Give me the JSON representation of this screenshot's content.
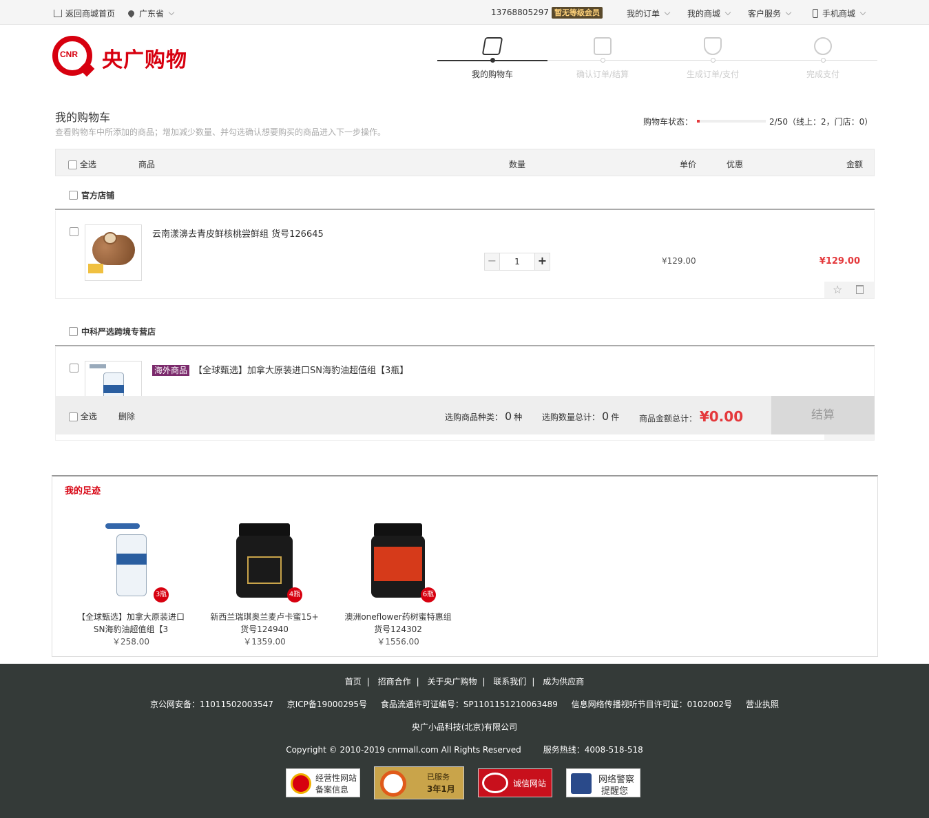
{
  "topbar": {
    "home": "返回商城首页",
    "province": "广东省",
    "phone": "13768805297",
    "vip": "暂无等级会员",
    "orders": "我的订单",
    "mall": "我的商城",
    "service": "客户服务",
    "mobile": "手机商城"
  },
  "logo": {
    "badge": "CNR",
    "name": "央广购物"
  },
  "steps": [
    "我的购物车",
    "确认订单/结算",
    "生成订单/支付",
    "完成支付"
  ],
  "cart": {
    "title": "我的购物车",
    "desc": "查看购物车中所添加的商品；增加减少数量、并勾选确认想要购买的商品进入下一步操作。",
    "status_label": "购物车状态：",
    "status_fraction": 0.04,
    "status_text": "2/50（线上：2，门店：0）"
  },
  "table_header": {
    "select_all": "全选",
    "product": "商品",
    "quantity": "数量",
    "unit_price": "单价",
    "discount": "优惠",
    "amount": "金额"
  },
  "stores": [
    {
      "name": "官方店铺",
      "product": {
        "name": "云南漾濞去青皮鲜核桃尝鲜组 货号126645",
        "quantity": "1",
        "price": "¥129.00",
        "amount": "¥129.00"
      }
    },
    {
      "name": "中科严选跨境专营店",
      "product": {
        "tag": "海外商品",
        "name": "【全球甄选】加拿大原装进口SN海豹油超值组【3瓶】"
      }
    }
  ],
  "checkout": {
    "select_all": "全选",
    "delete": "删除",
    "kinds_label": "选购商品种类：",
    "kinds_value": "0",
    "kinds_unit": "种",
    "count_label": "选购数量总计：",
    "count_value": "0",
    "count_unit": "件",
    "total_label": "商品金额总计：",
    "total_value": "¥0.00",
    "button": "结算"
  },
  "footprint": {
    "title": "我的足迹",
    "items": [
      {
        "name": "【全球甄选】加拿大原装进口SN海豹油超值组【3",
        "price": "￥258.00",
        "badge": "3瓶"
      },
      {
        "name": "新西兰瑞琪奥兰麦卢卡蜜15+ 货号124940",
        "price": "￥1359.00",
        "badge": "4瓶"
      },
      {
        "name": "澳洲oneflower药树蜜特惠组 货号124302",
        "price": "￥1556.00",
        "badge": "6瓶"
      }
    ]
  },
  "footer": {
    "links": [
      "首页",
      "招商合作",
      "关于央广购物",
      "联系我们",
      "成为供应商"
    ],
    "licenses": [
      "京公网安备：11011502003547",
      "京ICP备19000295号",
      "食品流通许可证编号：SP1101151210063489",
      "信息网络传播视听节目许可证：0102002号",
      "营业执照"
    ],
    "company": "央广小品科技(北京)有限公司",
    "copyright": "Copyright © 2010-2019  cnrmall.com  All  Rights  Reserved",
    "hotline": "服务热线：4008-518-518",
    "badges": {
      "b1_line1": "经营性网站",
      "b1_line2": "备案信息",
      "b2_line1": "已服务",
      "b2_line2": "3年1月",
      "b3": "诚信网站",
      "b4_line1": "网络警察",
      "b4_line2": "提醒您"
    }
  }
}
